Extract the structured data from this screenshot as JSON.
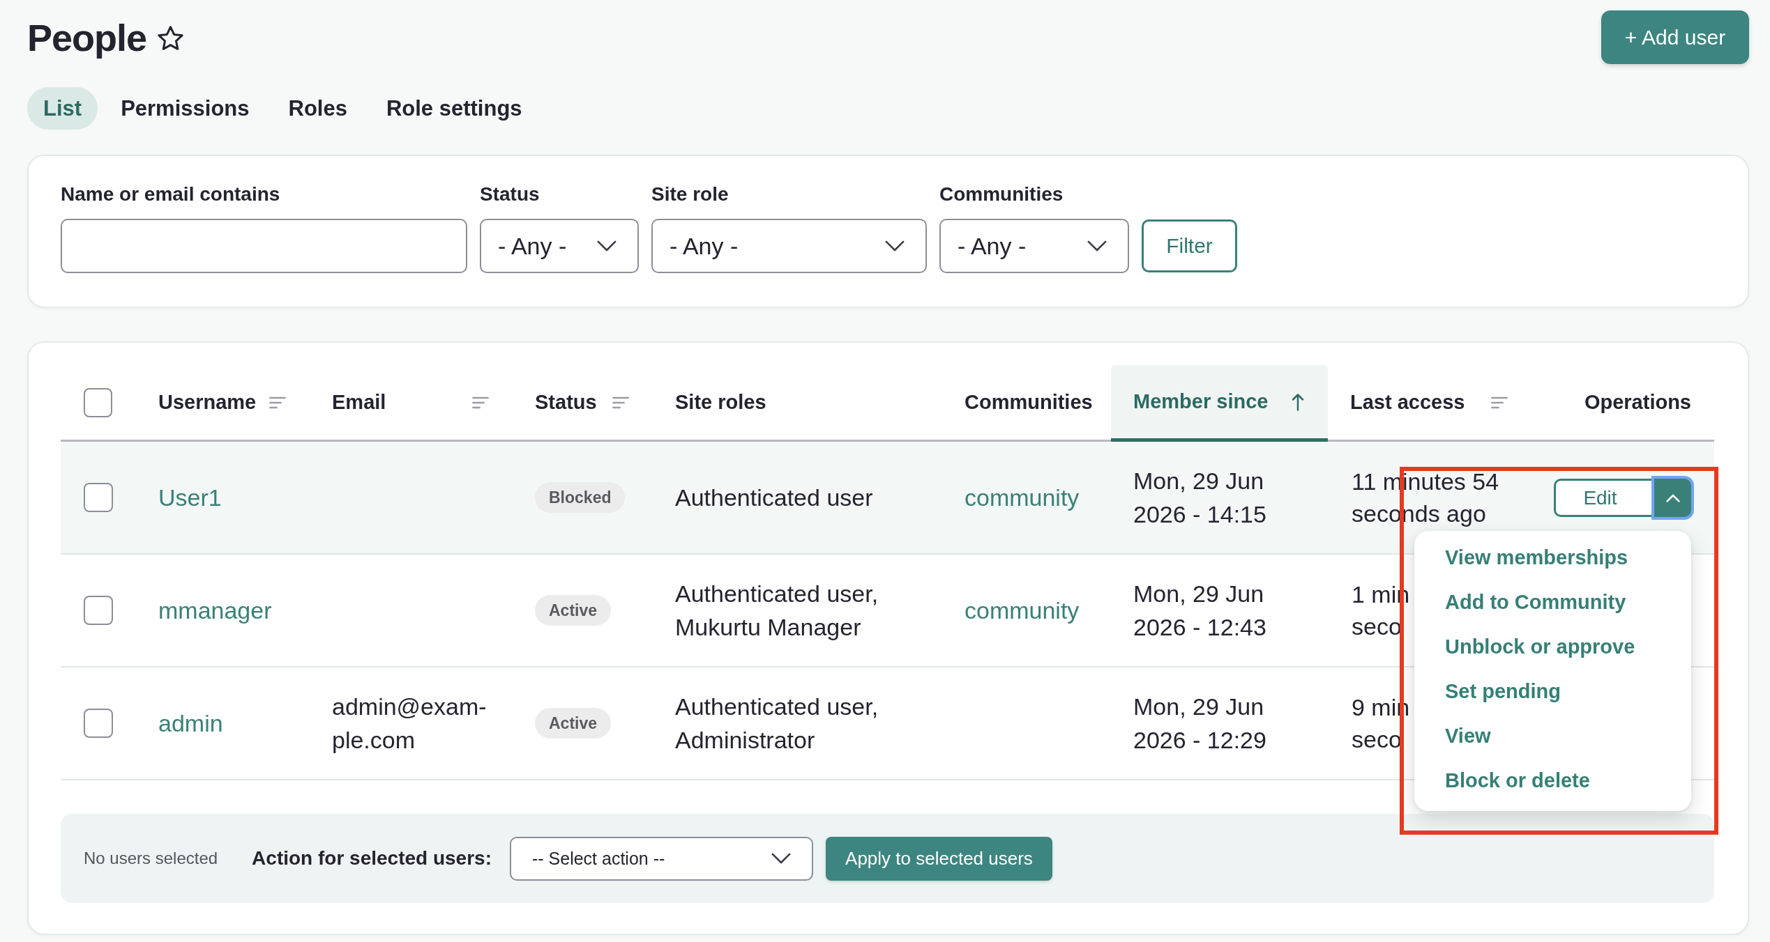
{
  "header": {
    "title": "People",
    "starred": false,
    "add_button": "+ Add user"
  },
  "tabs": [
    {
      "label": "List",
      "selected": true
    },
    {
      "label": "Permissions",
      "selected": false
    },
    {
      "label": "Roles",
      "selected": false
    },
    {
      "label": "Role settings",
      "selected": false
    }
  ],
  "filters": {
    "fields": [
      {
        "kind": "text",
        "label": "Name or email contains"
      },
      {
        "kind": "select",
        "label": "Status",
        "value": "- Any -"
      },
      {
        "kind": "select",
        "label": "Site role",
        "value": "- Any -"
      },
      {
        "kind": "select",
        "label": "Communities",
        "value": "- Any -"
      }
    ],
    "button": "Filter"
  },
  "table": {
    "select_all": {
      "checked": false
    },
    "columns": [
      {
        "label": "Username",
        "sortable": true,
        "selected": false
      },
      {
        "label": "Email",
        "sortable": true,
        "selected": false
      },
      {
        "label": "Status",
        "sortable": true,
        "selected": false
      },
      {
        "label": "Site roles",
        "sortable": false,
        "selected": false
      },
      {
        "label": "Communities",
        "sortable": false,
        "selected": false
      },
      {
        "label": "Member since",
        "sortable": true,
        "selected": true,
        "descending": false
      },
      {
        "label": "Last access",
        "sortable": true,
        "selected": false
      },
      {
        "label": "Operations",
        "sortable": false,
        "selected": false
      }
    ],
    "rows": [
      {
        "checked": false,
        "hovered": true,
        "username": "User1",
        "status": "Blocked",
        "site_roles": "Authenticated user",
        "communities": "community",
        "member_since": "Mon, 29 Jun 2026 - 14:15",
        "last_access": [
          "11 minutes 54",
          "seconds ago"
        ],
        "operations": {
          "button": "Edit",
          "expanded": true,
          "focused": true,
          "menu": [
            "View memberships",
            "Add to Community",
            "Unblock or approve",
            "Set pending",
            "View",
            "Block or delete"
          ]
        }
      },
      {
        "checked": false,
        "hovered": false,
        "username": "mmanager",
        "status": "Active",
        "site_roles": "Authenticated user, Mukurtu Manager",
        "communities": "community",
        "member_since": "Mon, 29 Jun 2026 - 12:43",
        "last_access": [
          "1 min",
          "seco"
        ]
      },
      {
        "checked": false,
        "hovered": false,
        "username": "admin",
        "email": "admin@exam-ple.com",
        "status": "Active",
        "site_roles": "Authenticated user, Administrator",
        "member_since": "Mon, 29 Jun 2026 - 12:29",
        "last_access": [
          "9 min",
          "seco"
        ]
      }
    ]
  },
  "bulk_actions": {
    "selection": "No users selected",
    "label": "Action for selected users:",
    "select": "-- Select action --",
    "apply_button": "Apply to selected users"
  }
}
